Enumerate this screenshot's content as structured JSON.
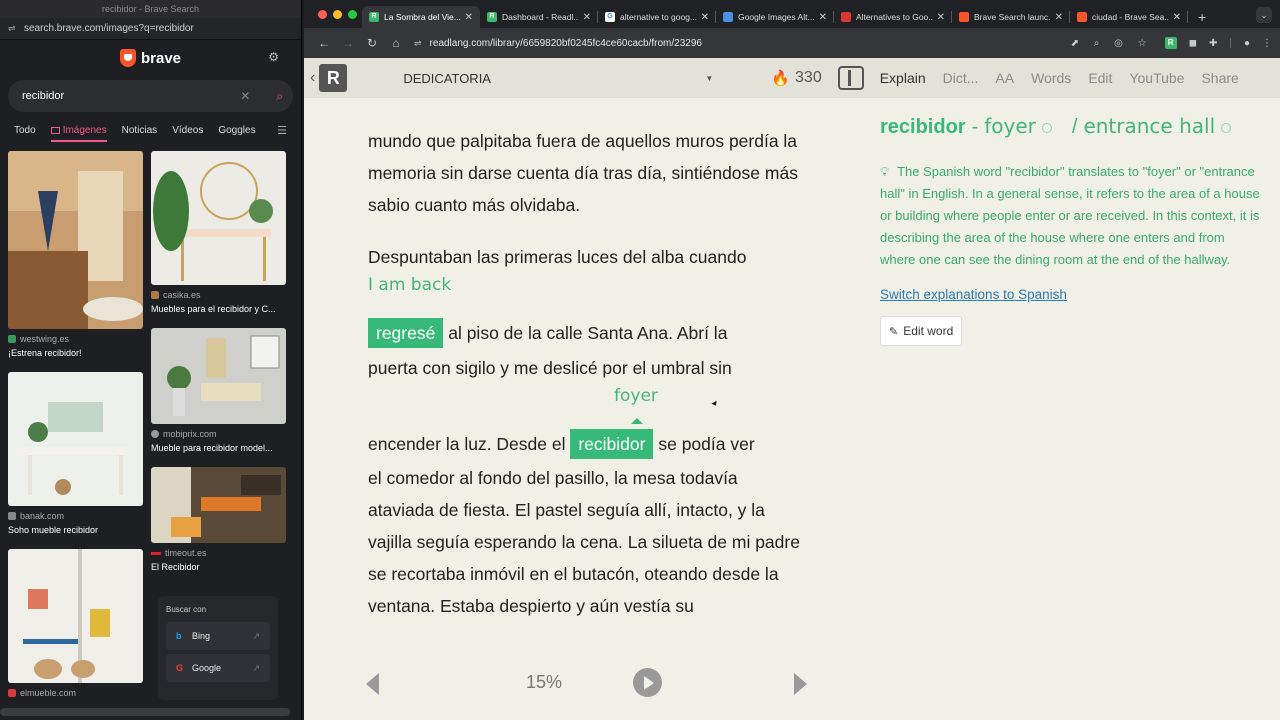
{
  "left_window": {
    "title": "recibidor - Brave Search",
    "url": "search.brave.com/images?q=recibidor",
    "brand": "brave",
    "search": {
      "value": "recibidor",
      "placeholder": ""
    },
    "tabs": [
      {
        "label": "Todo"
      },
      {
        "label": "Imágenes"
      },
      {
        "label": "Noticias"
      },
      {
        "label": "Vídeos"
      },
      {
        "label": "Goggles"
      }
    ],
    "results": [
      {
        "source": "westwing.es",
        "caption": "¡Estrena recibidor!"
      },
      {
        "source": "casika.es",
        "caption": "Muebles para el recibidor y C..."
      },
      {
        "source": "mobiprix.com",
        "caption": "Mueble para recibidor model..."
      },
      {
        "source": "banak.com",
        "caption": "Soho mueble recibidor"
      },
      {
        "source": "timeout.es",
        "caption": "El Recibidor"
      },
      {
        "source": "elmueble.com",
        "caption": ""
      }
    ],
    "buscar_con": {
      "label": "Buscar con",
      "engines": [
        {
          "name": "Bing"
        },
        {
          "name": "Google"
        }
      ]
    }
  },
  "right_window": {
    "tabs": [
      {
        "title": "La Sombra del Vie...",
        "active": true,
        "color": "#3bb86a",
        "glyph": "R"
      },
      {
        "title": "Dashboard - Readl...",
        "active": false,
        "color": "#3bb86a",
        "glyph": "R"
      },
      {
        "title": "alternative to goog...",
        "active": false,
        "color": "#ffffff",
        "glyph": "G"
      },
      {
        "title": "Google Images Alt...",
        "active": false,
        "color": "#4a90e2",
        "glyph": ""
      },
      {
        "title": "Alternatives to Goo...",
        "active": false,
        "color": "#d9382f",
        "glyph": ""
      },
      {
        "title": "Brave Search launc...",
        "active": false,
        "color": "#fb542b",
        "glyph": ""
      },
      {
        "title": "ciudad - Brave Sea...",
        "active": false,
        "color": "#fb542b",
        "glyph": ""
      }
    ],
    "url": "readlang.com/library/6659820bf0245fc4ce60cacb/from/23296",
    "readlang": {
      "logo": "R",
      "chapter": "DEDICATORIA",
      "streak": "330",
      "menu": [
        "Explain",
        "Dict...",
        "AA",
        "Words",
        "Edit",
        "YouTube",
        "Share"
      ],
      "paragraphs": {
        "p1": "mundo que palpitaba fuera de aquellos muros perdía la memoria sin darse cuenta día tras día, sintiéndose más sabio cuanto más olvidaba.",
        "p2_line1": "Despuntaban las primeras luces del alba cuando",
        "p2_trans": "I am back",
        "p2_word": "regresé",
        "p2_line2": "al piso de la calle Santa Ana. Abrí la",
        "p2_line3": "puerta con sigilo y me deslicé por el umbral sin",
        "p3_trans": "foyer",
        "p3_before": "encender la luz. Desde el",
        "p3_word": "recibidor",
        "p3_after": "se podía ver",
        "p3_rest": "el comedor al fondo del pasillo, la mesa todavía ataviada de fiesta. El pastel seguía allí, intacto, y la vajilla seguía esperando la cena. La silueta de mi padre se recortaba inmóvil en el butacón, oteando desde la ventana. Estaba despierto y aún vestía su"
      },
      "progress": "15%",
      "explain": {
        "word": "recibidor",
        "translations": [
          "foyer",
          "entrance hall"
        ],
        "text": "The Spanish word \"recibidor\" translates to \"foyer\" or \"entrance hall\" in English. In a general sense, it refers to the area of a house or building where people enter or are received. In this context, it is describing the area of the house where one enters and from where one can see the dining room at the end of the hallway.",
        "switch_link": "Switch explanations to Spanish",
        "edit_button": "Edit word"
      }
    }
  },
  "colors": {
    "accent": "#36b979",
    "link": "#2a7ab2",
    "brave_pink": "#f05a86"
  }
}
